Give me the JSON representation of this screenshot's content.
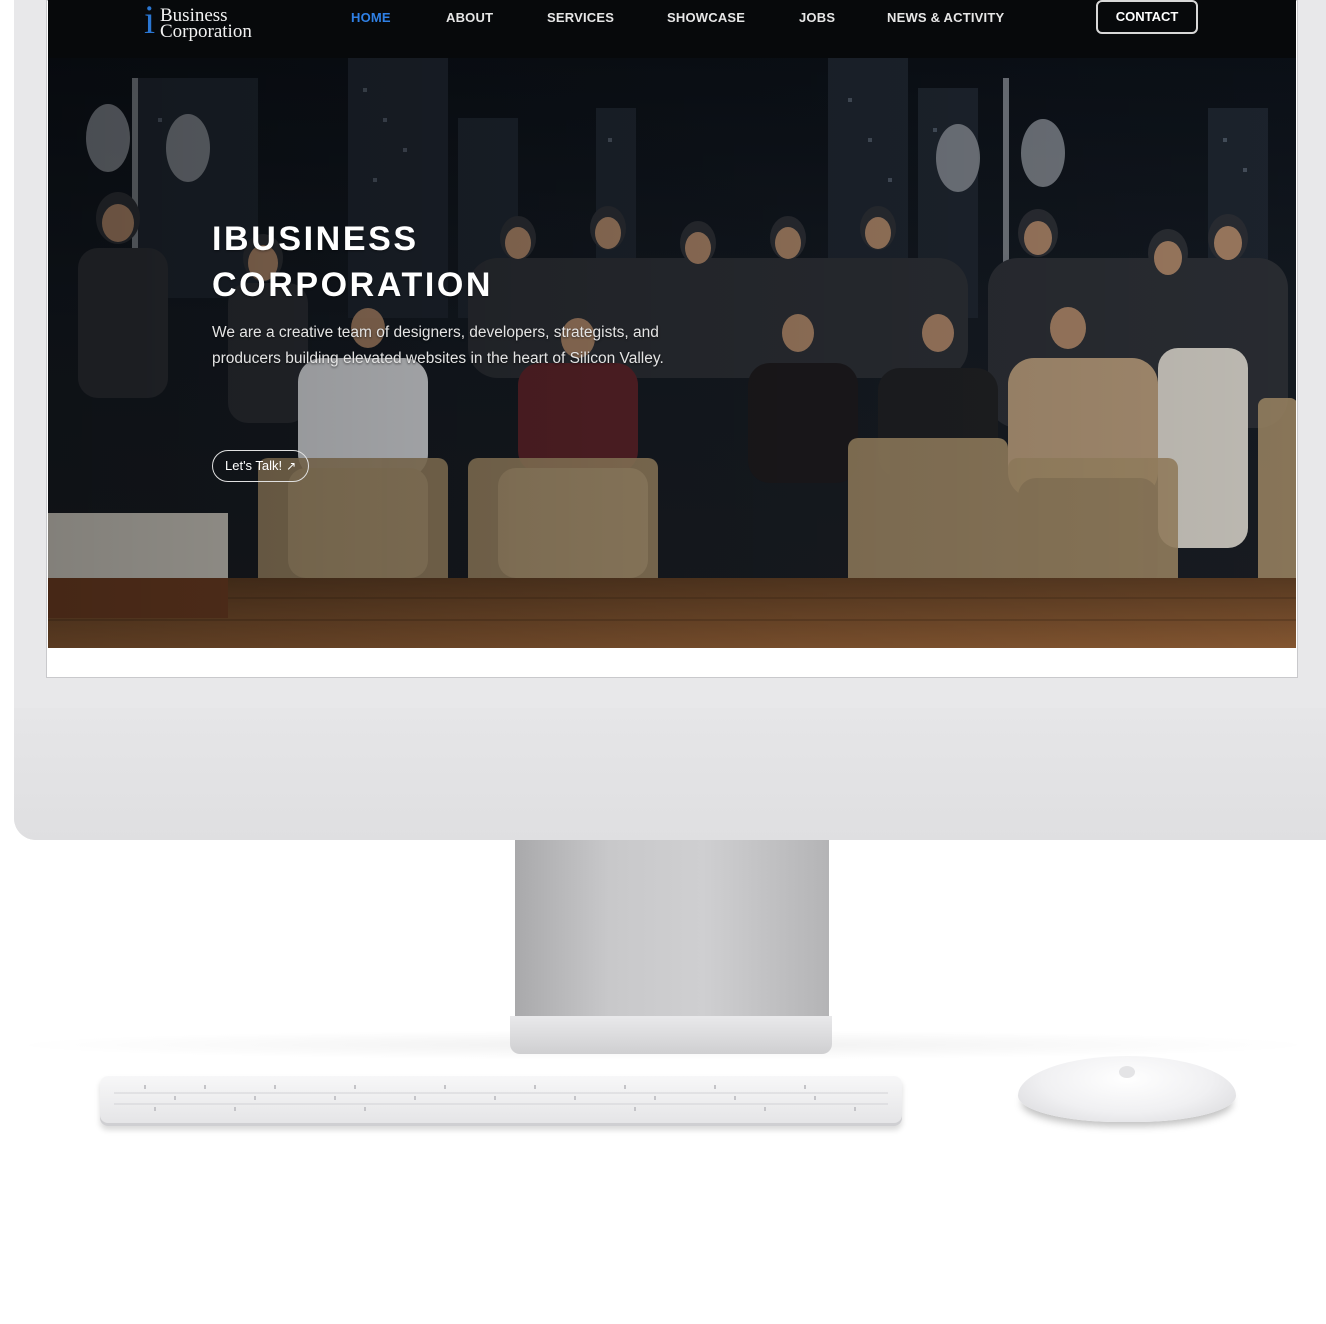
{
  "brand": {
    "logo_mark": "i",
    "logo_line1": "Business",
    "logo_line2": "Corporation"
  },
  "nav": {
    "items": [
      {
        "label": "HOME",
        "active": true
      },
      {
        "label": "ABOUT",
        "active": false
      },
      {
        "label": "SERVICES",
        "active": false
      },
      {
        "label": "SHOWCASE",
        "active": false
      },
      {
        "label": "JOBS",
        "active": false
      },
      {
        "label": "NEWS & ACTIVITY",
        "active": false
      }
    ],
    "contact_label": "CONTACT"
  },
  "hero": {
    "title_line1": "IBUSINESS",
    "title_line2": "CORPORATION",
    "subtitle": "We are a creative team of designers, developers, strategists, and producers building elevated websites in the heart of Silicon Valley.",
    "cta_label": "Let's Talk!",
    "cta_icon": "arrow-up-right-icon"
  },
  "colors": {
    "accent": "#2f80e5",
    "navbar_bg": "#07090b",
    "logo_blue": "#2a76d2"
  }
}
